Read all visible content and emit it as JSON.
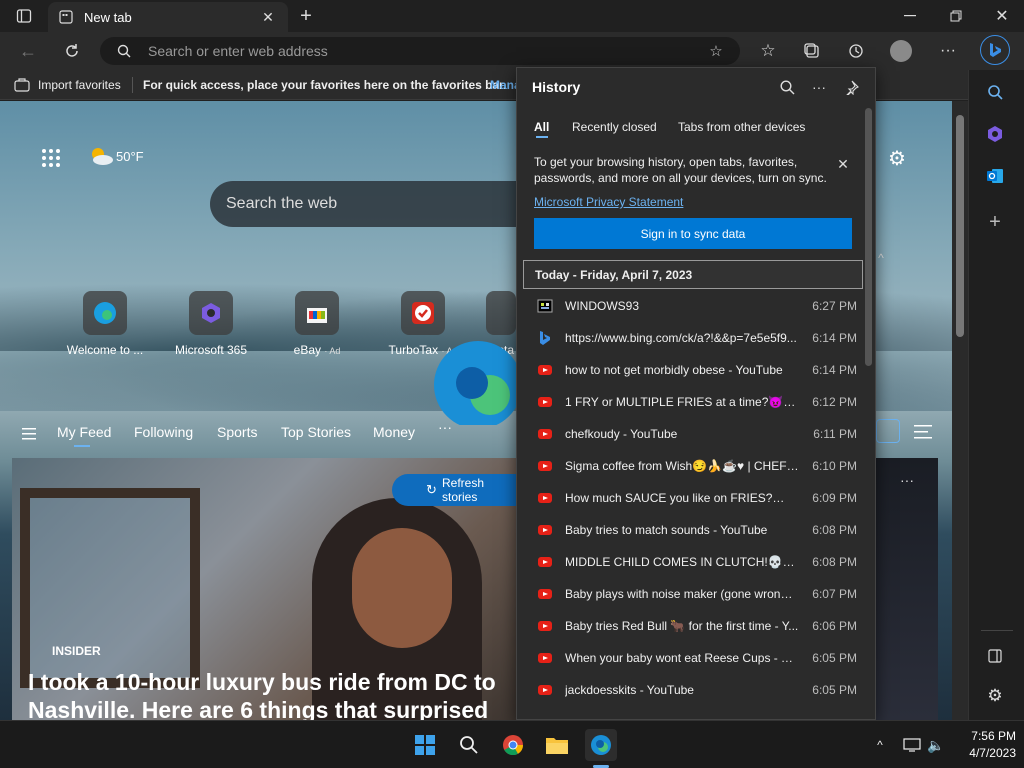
{
  "tab": {
    "title": "New tab"
  },
  "address": {
    "placeholder": "Search or enter web address"
  },
  "favbar": {
    "import_label": "Import favorites",
    "hint": "For quick access, place your favorites here on the favorites bar.",
    "manage_link": "Mana"
  },
  "newtab": {
    "weather": "50°F",
    "search_placeholder": "Search the web",
    "quicklinks": [
      {
        "label": "Welcome to ..."
      },
      {
        "label": "Microsoft 365"
      },
      {
        "label": "eBay",
        "ad": "· Ad"
      },
      {
        "label": "TurboTax",
        "ad": "· Ad"
      },
      {
        "label": "Insta"
      }
    ],
    "feed_tabs": [
      "My Feed",
      "Following",
      "Sports",
      "Top Stories",
      "Money"
    ],
    "refresh_label": "Refresh stories",
    "story": {
      "source": "INSIDER",
      "headline": "I took a 10-hour luxury bus ride from DC to Nashville. Here are 6 things that surprised me"
    }
  },
  "history": {
    "title": "History",
    "tabs": [
      "All",
      "Recently closed",
      "Tabs from other devices"
    ],
    "sync_message": "To get your browsing history, open tabs, favorites, passwords, and more on all your devices, turn on sync.",
    "privacy_link": "Microsoft Privacy Statement",
    "sign_in_label": "Sign in to sync data",
    "date_header": "Today - Friday, April 7, 2023",
    "items": [
      {
        "title": "WINDOWS93",
        "time": "6:27 PM",
        "icon": "windows93-icon"
      },
      {
        "title": "https://www.bing.com/ck/a?!&&p=7e5e5f9...",
        "time": "6:14 PM",
        "icon": "bing-icon"
      },
      {
        "title": "how to not get morbidly obese - YouTube",
        "time": "6:14 PM",
        "icon": "youtube-icon"
      },
      {
        "title": "1 FRY or MULTIPLE FRIES at a time?😈🔥...",
        "time": "6:12 PM",
        "icon": "youtube-icon"
      },
      {
        "title": "chefkoudy - YouTube",
        "time": "6:11 PM",
        "icon": "youtube-icon"
      },
      {
        "title": "Sigma coffee from Wish😏🍌☕♥ | CHEFK...",
        "time": "6:10 PM",
        "icon": "youtube-icon"
      },
      {
        "title": "How much SAUCE you like on FRIES?😏🍌",
        "time": "6:09 PM",
        "icon": "youtube-icon"
      },
      {
        "title": "Baby tries to match sounds - YouTube",
        "time": "6:08 PM",
        "icon": "youtube-icon"
      },
      {
        "title": "MIDDLE CHILD COMES IN CLUTCH!💀🤩 ...",
        "time": "6:08 PM",
        "icon": "youtube-icon"
      },
      {
        "title": "Baby plays with noise maker (gone wrong) ...",
        "time": "6:07 PM",
        "icon": "youtube-icon"
      },
      {
        "title": "Baby tries Red Bull 🐂 for the first time - Y...",
        "time": "6:06 PM",
        "icon": "youtube-icon"
      },
      {
        "title": "When your baby wont eat Reese Cups - Yo...",
        "time": "6:05 PM",
        "icon": "youtube-icon"
      },
      {
        "title": "jackdoesskits - YouTube",
        "time": "6:05 PM",
        "icon": "youtube-icon"
      }
    ]
  },
  "taskbar": {
    "time": "7:56 PM",
    "date": "4/7/2023"
  },
  "colors": {
    "accent": "#0078d4",
    "youtube": "#e62117",
    "panel": "#2b2b2b"
  }
}
